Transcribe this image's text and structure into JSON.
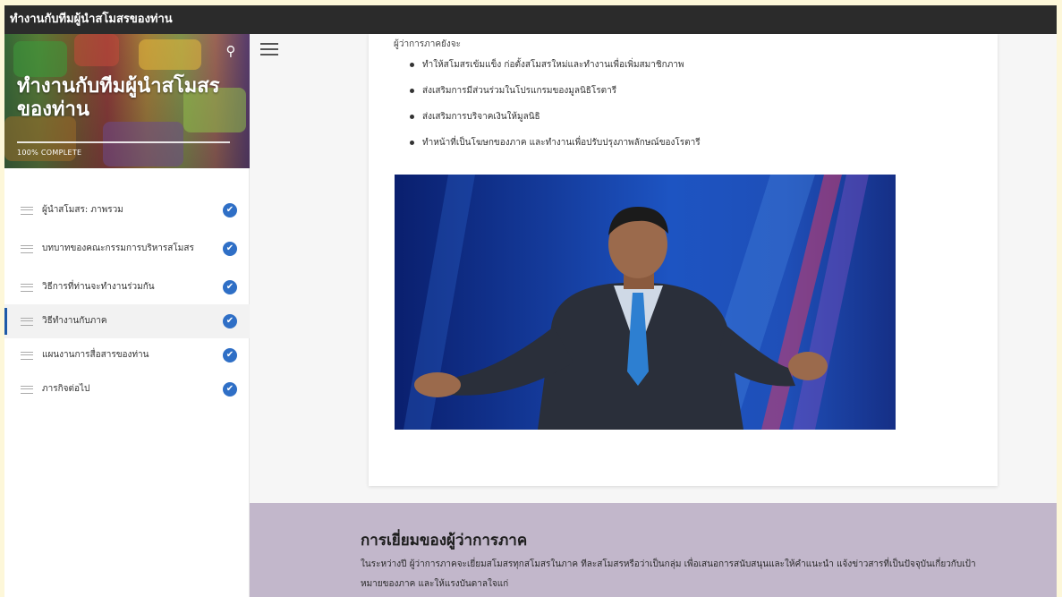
{
  "window": {
    "title": "ทำงานกับทีมผู้นำสโมสรของท่าน"
  },
  "sidebar": {
    "course_title": "ทำงานกับทีมผู้นำสโมสรของท่าน",
    "progress_percent": 100,
    "progress_label": "100% COMPLETE",
    "items": [
      {
        "label": "ผู้นำสโมสร: ภาพรวม",
        "complete": true,
        "active": false
      },
      {
        "label": "บทบาทของคณะกรรมการบริหารสโมสร",
        "complete": true,
        "active": false
      },
      {
        "label": "วิธีการที่ท่านจะทำงานร่วมกัน",
        "complete": true,
        "active": false
      },
      {
        "label": "วิธีทำงานกับภาค",
        "complete": true,
        "active": true
      },
      {
        "label": "แผนงานการสื่อสารของท่าน",
        "complete": true,
        "active": false
      },
      {
        "label": "ภารกิจต่อไป",
        "complete": true,
        "active": false
      }
    ],
    "check_glyph": "✔"
  },
  "icons": {
    "search": "search-icon",
    "menu": "hamburger-menu-icon",
    "check": "checkmark-circle-icon"
  },
  "content": {
    "lead": "ผู้ว่าการภาคยังจะ",
    "bullets": [
      "ทำให้สโมสรเข้มแข็ง ก่อตั้งสโมสรใหม่และทำงานเพื่อเพิ่มสมาชิกภาพ",
      "ส่งเสริมการมีส่วนร่วมในโปรแกรมของมูลนิธิโรตารี",
      "ส่งเสริมการบริจาคเงินให้มูลนิธิ",
      "ทำหน้าที่เป็นโฆษกของภาค และทำงานเพื่อปรับปรุงภาพลักษณ์ของโรตารี"
    ]
  },
  "section": {
    "title": "การเยี่ยมของผู้ว่าการภาค",
    "text": "ในระหว่างปี ผู้ว่าการภาคจะเยี่ยมสโมสรทุกสโมสรในภาค ทีละสโมสรหรือว่าเป็นกลุ่ม เพื่อเสนอการสนับสนุนและให้คำแนะนำ แจ้งข่าวสารที่เป็นปัจจุบันเกี่ยวกับเป้าหมายของภาค และให้แรงบันดาลใจแก่"
  },
  "colors": {
    "titlebar": "#2b2b2b",
    "accent": "#2f6fc6",
    "lower_band": "#c2b7cb"
  }
}
